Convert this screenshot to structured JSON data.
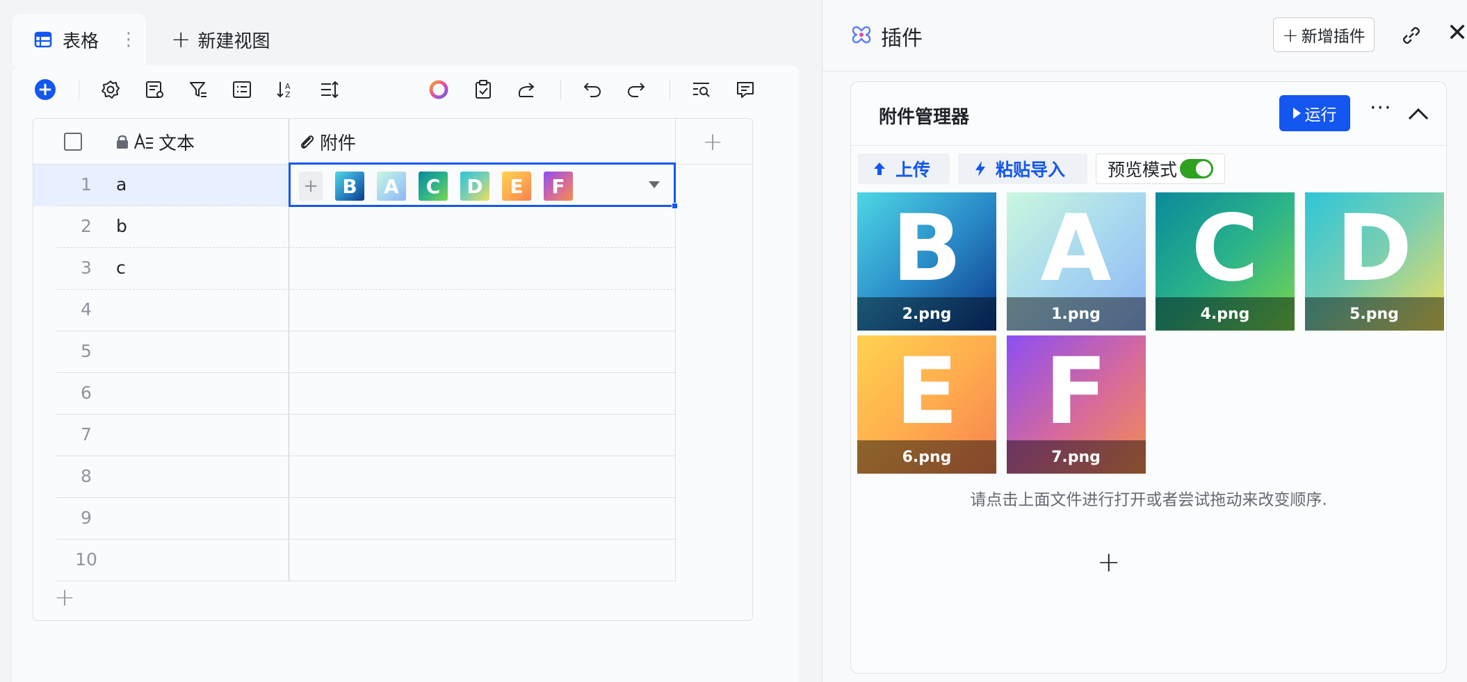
{
  "tabs": {
    "active_label": "表格",
    "more": "⋮",
    "new_view_label": "新建视图"
  },
  "grid": {
    "col_text_label": "文本",
    "col_attach_label": "附件",
    "add_col": "+",
    "add_row": "+",
    "rows": [
      {
        "num": "1",
        "text": "a"
      },
      {
        "num": "2",
        "text": "b"
      },
      {
        "num": "3",
        "text": "c"
      },
      {
        "num": "4",
        "text": ""
      },
      {
        "num": "5",
        "text": ""
      },
      {
        "num": "6",
        "text": ""
      },
      {
        "num": "7",
        "text": ""
      },
      {
        "num": "8",
        "text": ""
      },
      {
        "num": "9",
        "text": ""
      },
      {
        "num": "10",
        "text": ""
      }
    ],
    "attachments_small": [
      "B",
      "A",
      "C",
      "D",
      "E",
      "F"
    ],
    "attach_add": "+"
  },
  "plugin_panel": {
    "title": "插件",
    "add_plugin_label": "新增插件",
    "close": "✕",
    "card": {
      "title": "附件管理器",
      "run_label": "运行",
      "more": "···",
      "upload_label": "上传",
      "paste_label": "粘贴导入",
      "preview_label": "预览模式",
      "files": [
        {
          "letter": "B",
          "name": "2.png"
        },
        {
          "letter": "A",
          "name": "1.png"
        },
        {
          "letter": "C",
          "name": "4.png"
        },
        {
          "letter": "D",
          "name": "5.png"
        },
        {
          "letter": "E",
          "name": "6.png"
        },
        {
          "letter": "F",
          "name": "7.png"
        }
      ],
      "hint": "请点击上面文件进行打开或者尝试拖动来改变顺序.",
      "add": "+"
    }
  },
  "colors": {
    "primary": "#1456f0",
    "toggle_on": "#2ea121",
    "border": "#dee0e3"
  }
}
